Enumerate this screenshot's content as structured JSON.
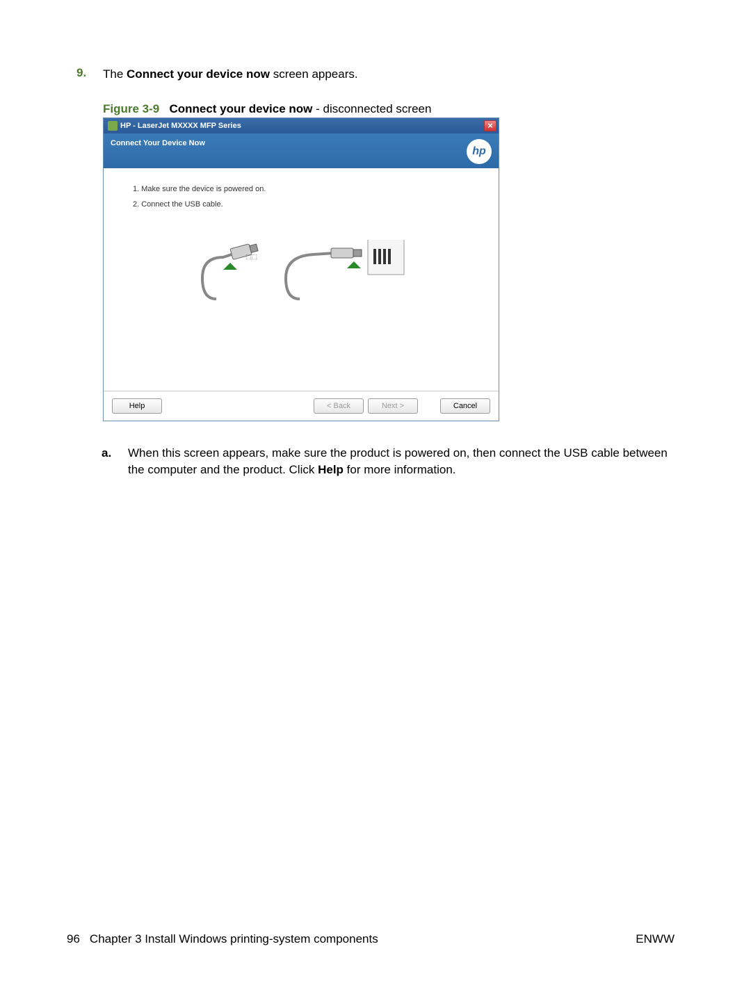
{
  "step": {
    "number": "9.",
    "text_before": "The ",
    "bold": "Connect your device now",
    "text_after": " screen appears."
  },
  "figure": {
    "label": "Figure 3-9",
    "title_bold": "Connect your device now",
    "title_after": " - disconnected screen"
  },
  "dialog": {
    "title": "HP - LaserJet MXXXX MFP Series",
    "close": "×",
    "subheader": "Connect Your Device Now",
    "logo": "hp",
    "body_lines": [
      "1. Make sure the device is powered on.",
      "2. Connect the USB cable."
    ],
    "buttons": {
      "help": "Help",
      "back": "< Back",
      "next": "Next >",
      "cancel": "Cancel"
    }
  },
  "substep": {
    "letter": "a.",
    "text_before": "When this screen appears, make sure the product is powered on, then connect the USB cable between the computer and the product. Click ",
    "bold": "Help",
    "text_after": " for more information."
  },
  "footer": {
    "page_num": "96",
    "chapter": "Chapter 3   Install Windows printing-system components",
    "right": "ENWW"
  }
}
